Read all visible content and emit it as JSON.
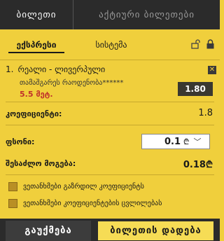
{
  "tabs": {
    "ticket": "ბილეთი",
    "active_tickets": "აქტიური ბილეთები"
  },
  "subtabs": {
    "express": "ექსპრესი",
    "system": "სისტემა"
  },
  "bet": {
    "number": "1.",
    "match": "რეალი - ლივერპული",
    "market": "თამაშგარეს რაოდენობა******",
    "minutes": "5.5 მეტ.",
    "odd": "1.80"
  },
  "summary": {
    "coef_label": "კოეფიციენტი:",
    "coef_value": "1.8",
    "stake_label": "ფსონი:",
    "stake_value": "0.1",
    "possible_win_label": "შესაძლო მოგება:",
    "possible_win_value": "0.18"
  },
  "options": {
    "accept_lower": "ვეთანხმები გაზრდილ კოეფიციენტს",
    "accept_changes": "ვეთანხმები კოეფიციენტების ცვლილებას"
  },
  "buttons": {
    "cancel": "გაუქმება",
    "place": "ბილეთის დადება"
  },
  "icons": {
    "currency": "lari-icon",
    "unlock": "unlock-icon",
    "lock": "lock-icon",
    "close": "close-icon",
    "chevron": "chevron-down-icon"
  },
  "colors": {
    "accent": "#f0cf3c",
    "dark": "#2b2b2b",
    "minutes": "#c0312b"
  }
}
